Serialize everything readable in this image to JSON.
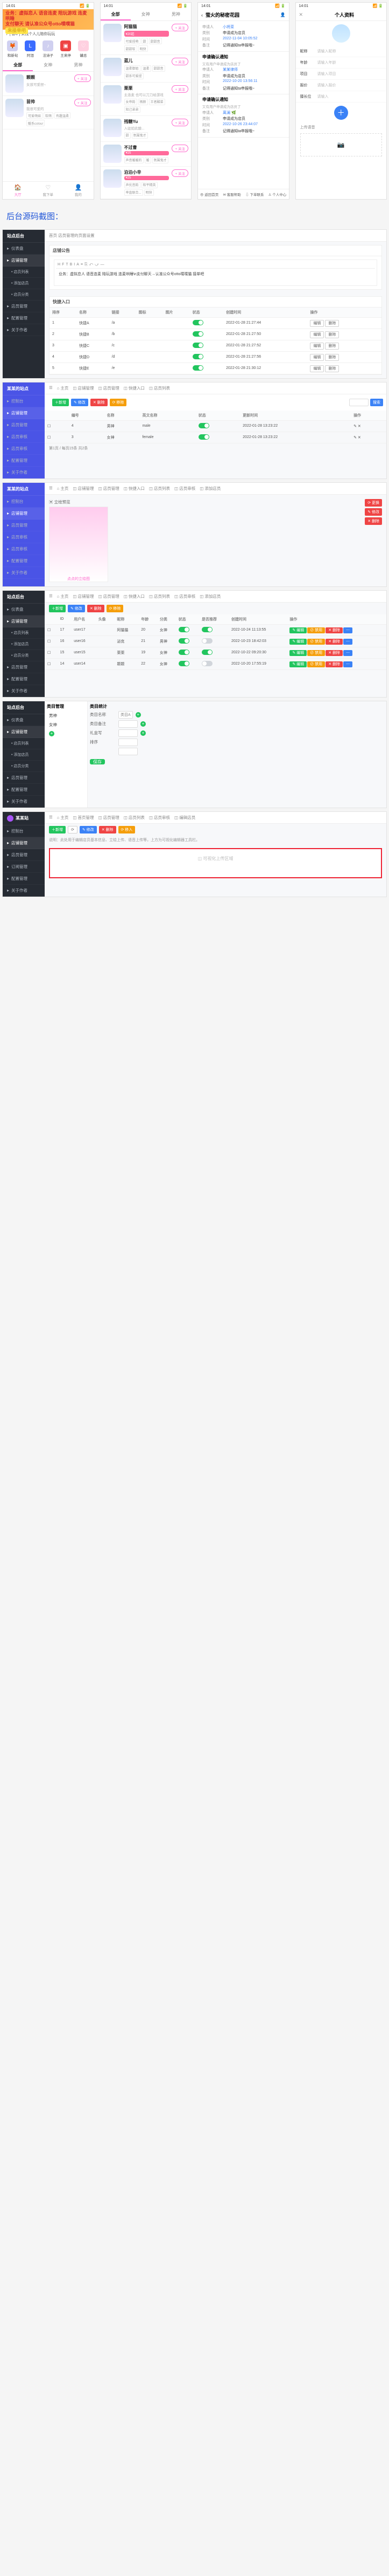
{
  "phones": {
    "statusbar": {
      "time": "14:01",
      "nettext": "◎",
      "battery": "▮▮ 80"
    },
    "banner": {
      "line1": "业务：虚拟恋人 语音连麦 陪玩游戏 连麦哄睡",
      "line2_a": "支付聊天",
      "line2_b": "请认准公众号otto噗噗猫",
      "pill": "来接单吧"
    },
    "notice": "[ 暂C ] 来找个人儿陪你玩玩",
    "noticeicon": "♪",
    "avrow": [
      {
        "icon": "🦊",
        "label": "和新旬"
      },
      {
        "icon": "L",
        "label": "阿泪",
        "bg": "#3b6cff"
      },
      {
        "icon": "♪",
        "label": "法诗子"
      },
      {
        "icon": "▣",
        "label": "王来停",
        "bg": "#e44"
      },
      {
        "icon": "♡",
        "label": "罐总",
        "bg": "#ffd0e0"
      }
    ],
    "tabs1": [
      "全部",
      "女神",
      "男神"
    ],
    "users_a": [
      {
        "name": "颗颗",
        "sub": "女孩可爱捏~",
        "tags": [],
        "btn": "+ 关注"
      },
      {
        "name": "苗帅",
        "sub": "我很可爱的",
        "tags": [
          "可爱萌妹",
          "软萌",
          "有趣温柔",
          "暖系colour"
        ],
        "btn": "+ 关注"
      }
    ],
    "bottom": [
      {
        "icon": "🏠",
        "label": "大厅"
      },
      {
        "icon": "♡",
        "label": "我下单"
      },
      {
        "icon": "👤",
        "label": "我的"
      }
    ],
    "tabs2": [
      "全部",
      "女神",
      "男神"
    ],
    "users_b": [
      {
        "name": "阿猫猫",
        "pill": "¥20起",
        "tags": [
          "可爱捏萌",
          "甜",
          "甜甜音",
          "甜甜软",
          "明快"
        ],
        "btn": "+ 关注"
      },
      {
        "name": "蓝儿",
        "pill": "",
        "tags": [
          "温柔御姐",
          "温柔",
          "甜甜音",
          "甜系可爱捏"
        ],
        "btn": "+ 关注"
      },
      {
        "name": "栗栗",
        "pill": "",
        "tags": [
          "女帝韵",
          "栖颜",
          "王者酸菜",
          "知己弟弟"
        ],
        "sub": "主连麦 也可以刀刀给游戏",
        "btn": "+ 关注"
      },
      {
        "name": "残糖Yu",
        "pill": "",
        "tags": [
          "甜",
          "氛围鬼才"
        ],
        "sub": "入驻如此酸...",
        "btn": "+ 关注"
      },
      {
        "name": "不过曹",
        "pill": "¥25",
        "tags": [
          "声音暖暖的",
          "暖",
          "氛围鬼才"
        ],
        "btn": "+ 关注"
      },
      {
        "name": "泊泊小辛",
        "pill": "¥25",
        "tags": [
          "声优音韵",
          "和平精英",
          "率直联合...",
          "明快"
        ],
        "btn": "+ 关注"
      }
    ],
    "detail": {
      "title": "萤火的秘密花园",
      "row1": {
        "name": "小将菜",
        "k1": "申请人",
        "k2": "类别",
        "v2": "申请成为店员",
        "k3": "时间",
        "v3": "2022-11-04 10:05:52",
        "k4": "备注",
        "v4": "记得通知ta申报哦~"
      },
      "box1": {
        "title": "申请确认通知",
        "line": "又有用户申请成为店员了",
        "k1": "申请人",
        "v1": "某某律师",
        "k2": "类别",
        "v2": "申请成为店员",
        "k3": "时间",
        "v3": "2022-10-20 13:56:11",
        "k4": "备注",
        "v4": "记得通知ta申报哦~"
      },
      "box2": {
        "title": "申请确认通知",
        "line": "又有用户申请成为店员了",
        "k1": "申请人",
        "v1": "离澜 🌿",
        "k2": "类别",
        "v2": "申请成为店员",
        "k3": "时间",
        "v3": "2022-10-26 23:44:07",
        "k4": "备注",
        "v4": "记得通知ta申报哦~"
      },
      "foot": [
        "⊕ 返回首页",
        "✉ 客服帮助",
        "⇩ 下单联系",
        "♙ 个人中心"
      ]
    },
    "profile": {
      "title": "个人资料",
      "fields": [
        {
          "l": "昵称",
          "p": "请输入昵称"
        },
        {
          "l": "年龄",
          "p": "请输入年龄"
        },
        {
          "l": "项目",
          "p": "请输入项目"
        },
        {
          "l": "报价",
          "p": "请输入报价"
        },
        {
          "l": "擅长位",
          "p": "请输入"
        }
      ],
      "seclabel": "上传语音",
      "up": "📷"
    }
  },
  "bigtitle": "后台源码截图：",
  "adminA": {
    "logo": "站点后台",
    "nav": [
      "仪表盘",
      "店铺管理",
      "店员管理",
      "配置管理",
      "关于作者"
    ],
    "sub": [
      "店员列表",
      "添加店员",
      "店员分类"
    ],
    "crumb": "首页 店员管理的页面设置",
    "crumb2": "店铺公告",
    "wys_tools": [
      "H",
      "F",
      "T",
      "B",
      "I",
      "A",
      "≡",
      "⎘",
      "⤺",
      "⤻",
      "—"
    ],
    "wys_text": "业务：虚拟恋人 语音连麦 陪玩游戏 连麦哄睡\\n支付聊天→认准公众号otto噗噗猫 接单吧",
    "tabletitle": "快捷入口",
    "cols": [
      "排序",
      "名称",
      "链接",
      "图标",
      "图片",
      "状态",
      "创建时间",
      "操作"
    ],
    "rows": [
      {
        "s": "1",
        "n": "快捷A",
        "l": "/a",
        "st": true,
        "t": "2022-01-28 21:27:44"
      },
      {
        "s": "2",
        "n": "快捷B",
        "l": "/b",
        "st": true,
        "t": "2022-01-28 21:27:50"
      },
      {
        "s": "3",
        "n": "快捷C",
        "l": "/c",
        "st": true,
        "t": "2022-01-28 21:27:52"
      },
      {
        "s": "4",
        "n": "快捷D",
        "l": "/d",
        "st": true,
        "t": "2022-01-28 21:27:56"
      },
      {
        "s": "5",
        "n": "快捷E",
        "l": "/e",
        "st": true,
        "t": "2022-01-28 21:30:12"
      }
    ],
    "op": [
      "编辑",
      "删除"
    ]
  },
  "adminB": {
    "logo": "某某的站点",
    "nav": [
      "控制台",
      "店铺管理",
      "店员管理",
      "店员审核",
      "店员审核",
      "配置管理",
      "关于作者"
    ],
    "crumbtabs": [
      "☰",
      "⌂ 主页",
      "◫ 店铺管理",
      "◫ 店员管理",
      "◫ 快捷入口",
      "◫ 店员列表"
    ],
    "pills": [
      "＋新增",
      "✎ 修改",
      "✕ 删除",
      "⟳ 移除"
    ],
    "search": {
      "ph": "搜索",
      "btn": "搜索"
    },
    "cols": [
      "",
      "编号",
      "名称",
      "英文名称",
      "状态",
      "更新时间",
      "操作"
    ],
    "rows": [
      {
        "id": "4",
        "n": "男神",
        "en": "male",
        "st": true,
        "t": "2022-01-28 13:23:22"
      },
      {
        "id": "3",
        "n": "女神",
        "en": "female",
        "st": true,
        "t": "2022-01-28 13:23:22"
      }
    ],
    "pager": "第1页 / 每页15条 共2条",
    "op": "✎ ✕"
  },
  "adminC": {
    "crumbtabs": [
      "☰",
      "⌂ 主页",
      "◫ 店铺管理",
      "◫ 店员管理",
      "◫ 快捷入口",
      "◫ 店员列表",
      "◫ 店员审核",
      "◫ 添加店员"
    ],
    "anime_caption": "点点的立绘图",
    "anime_name": "▣ 立绘预览",
    "sideops": [
      "⟳ 更换",
      "✎ 修改",
      "✕ 删除"
    ],
    "pills": [
      "编辑",
      "跳过",
      "删除"
    ]
  },
  "adminD": {
    "cols": [
      "",
      "ID",
      "用户名",
      "头像",
      "昵称",
      "年龄",
      "分类",
      "状态",
      "是否推荐",
      "创建时间",
      "操作"
    ],
    "rows": [
      {
        "id": "17",
        "u": "user17",
        "n": "阿猫猫",
        "age": "20",
        "cat": "女神",
        "st": true,
        "rec": true,
        "t": "2022-10-24 11:13:55"
      },
      {
        "id": "16",
        "u": "user16",
        "n": "泌克",
        "age": "21",
        "cat": "男神",
        "st": true,
        "rec": false,
        "t": "2022-10-23 18:42:03"
      },
      {
        "id": "15",
        "u": "user15",
        "n": "栗栗",
        "age": "19",
        "cat": "女神",
        "st": true,
        "rec": true,
        "t": "2022-10-22 09:20:30"
      },
      {
        "id": "14",
        "u": "user14",
        "n": "颗颗",
        "age": "22",
        "cat": "女神",
        "st": true,
        "rec": false,
        "t": "2022-10-20 17:55:19"
      }
    ],
    "op": [
      "✎ 编辑",
      "⊘ 禁用",
      "✕ 删除",
      "⋯"
    ]
  },
  "adminE": {
    "left_h": "类目管理",
    "right_h": "类目统计",
    "left": [
      "男神",
      "女神"
    ],
    "formlabels": [
      "类目名称",
      "类目备注",
      "礼盒写",
      "排序",
      ""
    ],
    "forminputs": [
      "类目A",
      "",
      "",
      ""
    ],
    "btn": "保存"
  },
  "adminF": {
    "logo": "某某站",
    "nav": [
      "控制台",
      "店铺管理",
      "店员管理",
      "订阅管理",
      "配置管理",
      "关于作者"
    ],
    "crumbtabs": [
      "☰",
      "⌂ 主页",
      "◫ 首页管理",
      "◫ 店员管理",
      "◫ 店员列表",
      "◫ 店员审核",
      "◫ 编辑店员"
    ],
    "pills": [
      "＋新增",
      "⟳",
      "✎ 修改",
      "✕ 删除",
      "⟳ 移入"
    ],
    "infotxt": "说明：此处用于编辑店员基本信息、立绘上传、语音上传等，上方为可视化编辑器工具栏。",
    "red_inside": "◫ 可视化上传区域"
  }
}
